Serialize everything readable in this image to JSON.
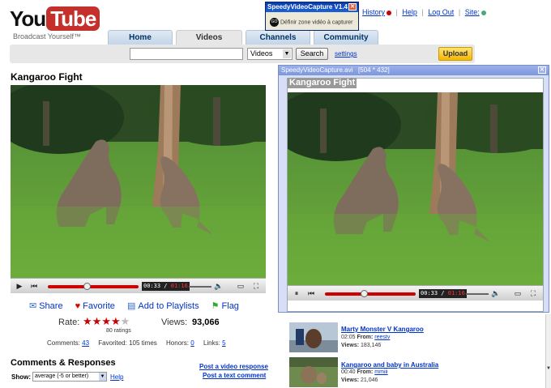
{
  "logo": {
    "you": "You",
    "tube": "Tube",
    "tagline": "Broadcast Yourself™"
  },
  "toplinks": {
    "history": "History",
    "help": "Help",
    "logout": "Log Out",
    "site": "Site:"
  },
  "tabs": [
    {
      "label": "Home"
    },
    {
      "label": "Videos"
    },
    {
      "label": "Channels"
    },
    {
      "label": "Community"
    }
  ],
  "search": {
    "value": "",
    "category": "Videos",
    "button": "Search",
    "settings": "settings"
  },
  "upload_label": "Upload",
  "video": {
    "title": "Kangaroo Fight",
    "time_current": "00:33",
    "time_total": "01:16",
    "progress": 0.43
  },
  "actions": {
    "share": "Share",
    "favorite": "Favorite",
    "add_to_playlists": "Add to Playlists",
    "flag": "Flag"
  },
  "rating": {
    "label": "Rate:",
    "stars": 4,
    "max": 5,
    "count_text": "80 ratings"
  },
  "views": {
    "label": "Views:",
    "value": "93,066"
  },
  "stats": {
    "comments_label": "Comments:",
    "comments": "43",
    "favorited_label": "Favorited:",
    "favorited": "105 times",
    "honors_label": "Honors:",
    "honors": "0",
    "links_label": "Links:",
    "links": "5"
  },
  "comments": {
    "title": "Comments & Responses",
    "post_video": "Post a video response",
    "post_text": "Post a text comment",
    "show_label": "Show:",
    "show_value": "average (-5 or better)",
    "help": "Help"
  },
  "capture_small": {
    "title": "SpeedyVideoCapture V1.4",
    "action": "Définir zone vidéo à capturer",
    "go": "GO"
  },
  "capture_window": {
    "title": "SpeedyVideoCapture.avi",
    "dims": "[504 * 432]",
    "overlay_title": "Kangaroo Fight",
    "time_current": "00:33",
    "time_total": "01:16"
  },
  "related": [
    {
      "title": "Marty Monster V Kangaroo",
      "time": "02:05",
      "from_label": "From:",
      "from": "reestv",
      "views_label": "Views:",
      "views": "183,146"
    },
    {
      "title": "Kangaroo and baby in Australia",
      "time": "00:40",
      "from_label": "From:",
      "from": "mmiii",
      "views_label": "Views:",
      "views": "21,046"
    }
  ],
  "colors": {
    "brand_red": "#c4302b",
    "link": "#0033cc",
    "seek": "#cc0000",
    "upload": "#f5b700"
  }
}
